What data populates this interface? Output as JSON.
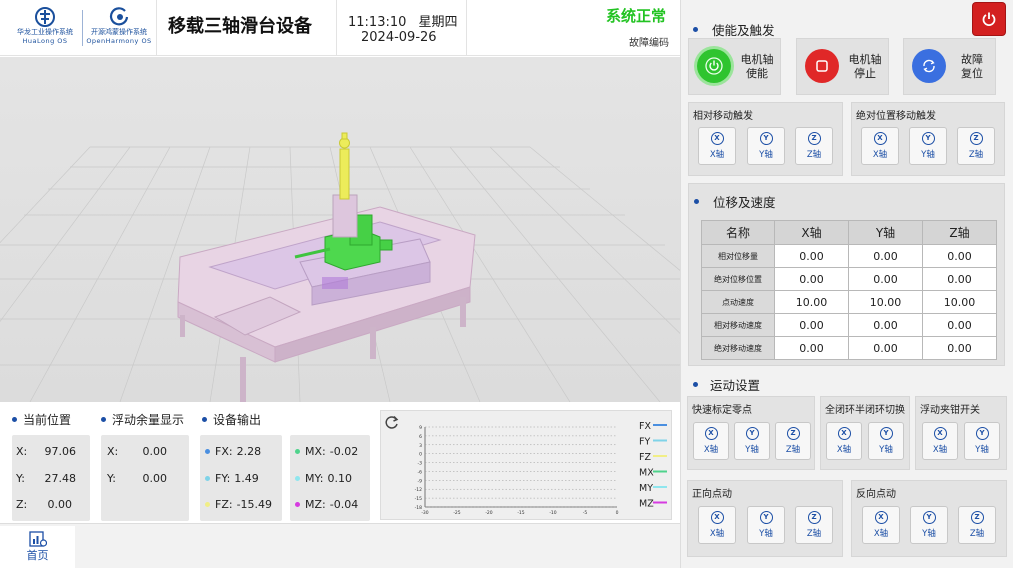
{
  "header": {
    "logo1_name": "华龙工业操作系统",
    "logo1_sub": "HuaLong OS",
    "logo2_name": "开源鸿蒙操作系统",
    "logo2_sub": "OpenHarmony OS",
    "title": "移载三轴滑台设备",
    "time": "11:13:10",
    "weekday": "星期四",
    "date": "2024-09-26",
    "status": "系统正常",
    "fault_code": "故障编码",
    "status_color": "#22c322"
  },
  "bottom": {
    "current_position": {
      "title": "当前位置",
      "rows": [
        {
          "label": "X:",
          "value": "97.06"
        },
        {
          "label": "Y:",
          "value": "27.48"
        },
        {
          "label": "Z:",
          "value": "0.00"
        }
      ]
    },
    "float_display": {
      "title": "浮动余量显示",
      "rows": [
        {
          "label": "X:",
          "value": "0.00"
        },
        {
          "label": "Y:",
          "value": "0.00"
        }
      ]
    },
    "device_output": {
      "title": "设备输出",
      "force": [
        {
          "label": "FX:",
          "value": "2.28",
          "color": "#4a8fe0"
        },
        {
          "label": "FY:",
          "value": "1.49",
          "color": "#7fd3e8"
        },
        {
          "label": "FZ:",
          "value": "-15.49",
          "color": "#f1ee86"
        }
      ],
      "moment": [
        {
          "label": "MX:",
          "value": "-0.02",
          "color": "#4fd38c"
        },
        {
          "label": "MY:",
          "value": "0.10",
          "color": "#8fe6ee"
        },
        {
          "label": "MZ:",
          "value": "-0.04",
          "color": "#d63be0"
        }
      ]
    }
  },
  "chart_data": {
    "type": "line",
    "x_ticks": [
      "-30",
      "-25",
      "-20",
      "-15",
      "-10",
      "-5",
      "0"
    ],
    "y_ticks": [
      "9",
      "6",
      "3",
      "0",
      "-3",
      "-6",
      "-9",
      "-12",
      "-15",
      "-18"
    ],
    "xlim": [
      -30,
      0
    ],
    "ylim": [
      -18,
      9
    ],
    "grid": true,
    "legend_position": "right",
    "series": [
      {
        "name": "FX",
        "color": "#4a8fe0",
        "values": []
      },
      {
        "name": "FY",
        "color": "#7fd3e8",
        "values": []
      },
      {
        "name": "FZ",
        "color": "#f1ee86",
        "values": []
      },
      {
        "name": "MX",
        "color": "#4fd38c",
        "values": []
      },
      {
        "name": "MY",
        "color": "#8fe6ee",
        "values": []
      },
      {
        "name": "MZ",
        "color": "#d63be0",
        "values": []
      }
    ]
  },
  "footer": {
    "home": "首页"
  },
  "right": {
    "enable_title": "使能及触发",
    "enable_buttons": [
      {
        "line1": "电机轴",
        "line2": "使能"
      },
      {
        "line1": "电机轴",
        "line2": "停止"
      },
      {
        "line1": "故障",
        "line2": "复位"
      }
    ],
    "relative_move": {
      "title": "相对移动触发",
      "axes": [
        "X轴",
        "Y轴",
        "Z轴"
      ],
      "icons": [
        "X",
        "Y",
        "Z"
      ]
    },
    "absolute_move": {
      "title": "绝对位置移动触发",
      "axes": [
        "X轴",
        "Y轴",
        "Z轴"
      ],
      "icons": [
        "X",
        "Y",
        "Z"
      ]
    },
    "displacement": {
      "title": "位移及速度",
      "headers": [
        "名称",
        "X轴",
        "Y轴",
        "Z轴"
      ],
      "rows": [
        {
          "name": "相对位移量",
          "x": "0.00",
          "y": "0.00",
          "z": "0.00"
        },
        {
          "name": "绝对位移位置",
          "x": "0.00",
          "y": "0.00",
          "z": "0.00"
        },
        {
          "name": "点动速度",
          "x": "10.00",
          "y": "10.00",
          "z": "10.00"
        },
        {
          "name": "相对移动速度",
          "x": "0.00",
          "y": "0.00",
          "z": "0.00"
        },
        {
          "name": "绝对移动速度",
          "x": "0.00",
          "y": "0.00",
          "z": "0.00"
        }
      ]
    },
    "motion_title": "运动设置",
    "quick_zero": {
      "title": "快速标定零点",
      "axes": [
        "X轴",
        "Y轴",
        "Z轴"
      ],
      "icons": [
        "X",
        "Y",
        "Z"
      ]
    },
    "loop_switch": {
      "title": "全闭环半闭环切换",
      "axes": [
        "X轴",
        "Y轴"
      ],
      "icons": [
        "X",
        "Y"
      ]
    },
    "clamp_switch": {
      "title": "浮动夹钳开关",
      "axes": [
        "X轴",
        "Y轴"
      ],
      "icons": [
        "X",
        "Y"
      ]
    },
    "jog_forward": {
      "title": "正向点动",
      "axes": [
        "X轴",
        "Y轴",
        "Z轴"
      ],
      "icons": [
        "X",
        "Y",
        "Z"
      ]
    },
    "jog_reverse": {
      "title": "反向点动",
      "axes": [
        "X轴",
        "Y轴",
        "Z轴"
      ],
      "icons": [
        "X",
        "Y",
        "Z"
      ]
    }
  },
  "colors": {
    "accent": "#1c4fa6",
    "enable_green": "#2fc42f",
    "stop_red": "#e02828",
    "reset_blue": "#3a6fe0",
    "power_red": "#d32020"
  },
  "icons": [
    "hualong-logo-icon",
    "openharmony-logo-icon",
    "power-icon",
    "refresh-icon",
    "home-chart-icon",
    "stop-icon",
    "reset-icon"
  ]
}
